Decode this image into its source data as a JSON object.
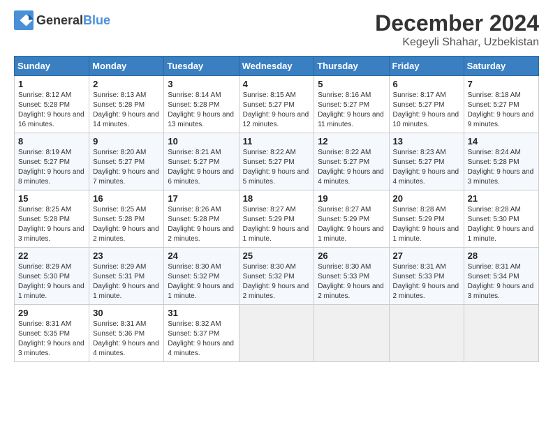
{
  "header": {
    "logo_general": "General",
    "logo_blue": "Blue",
    "month_year": "December 2024",
    "location": "Kegeyli Shahar, Uzbekistan"
  },
  "days_of_week": [
    "Sunday",
    "Monday",
    "Tuesday",
    "Wednesday",
    "Thursday",
    "Friday",
    "Saturday"
  ],
  "weeks": [
    [
      {
        "day": "1",
        "sunrise": "Sunrise: 8:12 AM",
        "sunset": "Sunset: 5:28 PM",
        "daylight": "Daylight: 9 hours and 16 minutes."
      },
      {
        "day": "2",
        "sunrise": "Sunrise: 8:13 AM",
        "sunset": "Sunset: 5:28 PM",
        "daylight": "Daylight: 9 hours and 14 minutes."
      },
      {
        "day": "3",
        "sunrise": "Sunrise: 8:14 AM",
        "sunset": "Sunset: 5:28 PM",
        "daylight": "Daylight: 9 hours and 13 minutes."
      },
      {
        "day": "4",
        "sunrise": "Sunrise: 8:15 AM",
        "sunset": "Sunset: 5:27 PM",
        "daylight": "Daylight: 9 hours and 12 minutes."
      },
      {
        "day": "5",
        "sunrise": "Sunrise: 8:16 AM",
        "sunset": "Sunset: 5:27 PM",
        "daylight": "Daylight: 9 hours and 11 minutes."
      },
      {
        "day": "6",
        "sunrise": "Sunrise: 8:17 AM",
        "sunset": "Sunset: 5:27 PM",
        "daylight": "Daylight: 9 hours and 10 minutes."
      },
      {
        "day": "7",
        "sunrise": "Sunrise: 8:18 AM",
        "sunset": "Sunset: 5:27 PM",
        "daylight": "Daylight: 9 hours and 9 minutes."
      }
    ],
    [
      {
        "day": "8",
        "sunrise": "Sunrise: 8:19 AM",
        "sunset": "Sunset: 5:27 PM",
        "daylight": "Daylight: 9 hours and 8 minutes."
      },
      {
        "day": "9",
        "sunrise": "Sunrise: 8:20 AM",
        "sunset": "Sunset: 5:27 PM",
        "daylight": "Daylight: 9 hours and 7 minutes."
      },
      {
        "day": "10",
        "sunrise": "Sunrise: 8:21 AM",
        "sunset": "Sunset: 5:27 PM",
        "daylight": "Daylight: 9 hours and 6 minutes."
      },
      {
        "day": "11",
        "sunrise": "Sunrise: 8:22 AM",
        "sunset": "Sunset: 5:27 PM",
        "daylight": "Daylight: 9 hours and 5 minutes."
      },
      {
        "day": "12",
        "sunrise": "Sunrise: 8:22 AM",
        "sunset": "Sunset: 5:27 PM",
        "daylight": "Daylight: 9 hours and 4 minutes."
      },
      {
        "day": "13",
        "sunrise": "Sunrise: 8:23 AM",
        "sunset": "Sunset: 5:27 PM",
        "daylight": "Daylight: 9 hours and 4 minutes."
      },
      {
        "day": "14",
        "sunrise": "Sunrise: 8:24 AM",
        "sunset": "Sunset: 5:28 PM",
        "daylight": "Daylight: 9 hours and 3 minutes."
      }
    ],
    [
      {
        "day": "15",
        "sunrise": "Sunrise: 8:25 AM",
        "sunset": "Sunset: 5:28 PM",
        "daylight": "Daylight: 9 hours and 3 minutes."
      },
      {
        "day": "16",
        "sunrise": "Sunrise: 8:25 AM",
        "sunset": "Sunset: 5:28 PM",
        "daylight": "Daylight: 9 hours and 2 minutes."
      },
      {
        "day": "17",
        "sunrise": "Sunrise: 8:26 AM",
        "sunset": "Sunset: 5:28 PM",
        "daylight": "Daylight: 9 hours and 2 minutes."
      },
      {
        "day": "18",
        "sunrise": "Sunrise: 8:27 AM",
        "sunset": "Sunset: 5:29 PM",
        "daylight": "Daylight: 9 hours and 1 minute."
      },
      {
        "day": "19",
        "sunrise": "Sunrise: 8:27 AM",
        "sunset": "Sunset: 5:29 PM",
        "daylight": "Daylight: 9 hours and 1 minute."
      },
      {
        "day": "20",
        "sunrise": "Sunrise: 8:28 AM",
        "sunset": "Sunset: 5:29 PM",
        "daylight": "Daylight: 9 hours and 1 minute."
      },
      {
        "day": "21",
        "sunrise": "Sunrise: 8:28 AM",
        "sunset": "Sunset: 5:30 PM",
        "daylight": "Daylight: 9 hours and 1 minute."
      }
    ],
    [
      {
        "day": "22",
        "sunrise": "Sunrise: 8:29 AM",
        "sunset": "Sunset: 5:30 PM",
        "daylight": "Daylight: 9 hours and 1 minute."
      },
      {
        "day": "23",
        "sunrise": "Sunrise: 8:29 AM",
        "sunset": "Sunset: 5:31 PM",
        "daylight": "Daylight: 9 hours and 1 minute."
      },
      {
        "day": "24",
        "sunrise": "Sunrise: 8:30 AM",
        "sunset": "Sunset: 5:32 PM",
        "daylight": "Daylight: 9 hours and 1 minute."
      },
      {
        "day": "25",
        "sunrise": "Sunrise: 8:30 AM",
        "sunset": "Sunset: 5:32 PM",
        "daylight": "Daylight: 9 hours and 2 minutes."
      },
      {
        "day": "26",
        "sunrise": "Sunrise: 8:30 AM",
        "sunset": "Sunset: 5:33 PM",
        "daylight": "Daylight: 9 hours and 2 minutes."
      },
      {
        "day": "27",
        "sunrise": "Sunrise: 8:31 AM",
        "sunset": "Sunset: 5:33 PM",
        "daylight": "Daylight: 9 hours and 2 minutes."
      },
      {
        "day": "28",
        "sunrise": "Sunrise: 8:31 AM",
        "sunset": "Sunset: 5:34 PM",
        "daylight": "Daylight: 9 hours and 3 minutes."
      }
    ],
    [
      {
        "day": "29",
        "sunrise": "Sunrise: 8:31 AM",
        "sunset": "Sunset: 5:35 PM",
        "daylight": "Daylight: 9 hours and 3 minutes."
      },
      {
        "day": "30",
        "sunrise": "Sunrise: 8:31 AM",
        "sunset": "Sunset: 5:36 PM",
        "daylight": "Daylight: 9 hours and 4 minutes."
      },
      {
        "day": "31",
        "sunrise": "Sunrise: 8:32 AM",
        "sunset": "Sunset: 5:37 PM",
        "daylight": "Daylight: 9 hours and 4 minutes."
      },
      null,
      null,
      null,
      null
    ]
  ]
}
